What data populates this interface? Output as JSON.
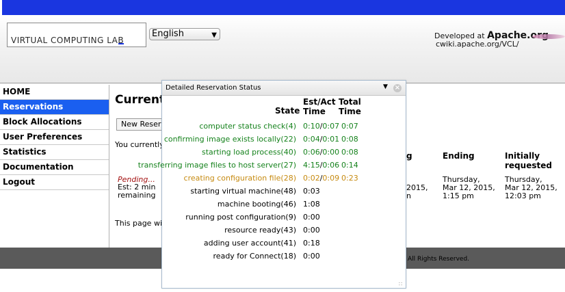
{
  "header": {
    "logo_text": "VIRTUAL COMPUTING LAB",
    "language": "English",
    "developed_prefix": "Developed at ",
    "developed_org": "Apache.org",
    "developed_link": "cwiki.apache.org/VCL/"
  },
  "sidebar": {
    "items": [
      {
        "label": "HOME"
      },
      {
        "label": "Reservations"
      },
      {
        "label": "Block Allocations"
      },
      {
        "label": "User Preferences"
      },
      {
        "label": "Statistics"
      },
      {
        "label": "Documentation"
      },
      {
        "label": "Logout"
      }
    ]
  },
  "main": {
    "title": "Current I",
    "new_reservation": "New Reservat",
    "currently": "You currently h",
    "pending": "Pending...",
    "est_line1": "Est: 2 min",
    "est_line2": "remaining",
    "page_will": "This page will a",
    "col_starting_partial": "g",
    "col_ending": "Ending",
    "col_initially_1": "Initially",
    "col_initially_2": "requested",
    "starting_partial_1": "2015,",
    "starting_partial_2": "n",
    "ending_1": "Thursday,",
    "ending_2": "Mar 12, 2015,",
    "ending_3": "1:15 pm",
    "initially_1": "Thursday,",
    "initially_2": "Mar 12, 2015,",
    "initially_3": "12:03 pm"
  },
  "footer": {
    "text": "All Rights Reserved."
  },
  "dialog": {
    "title": "Detailed Reservation Status",
    "col_state": "State",
    "col_estact_1": "Est/Act",
    "col_estact_2": "Time",
    "col_total_1": "Total",
    "col_total_2": "Time",
    "rows": [
      {
        "state": "computer status check(4)",
        "est": "0:10",
        "act": "0:07",
        "total": "0:07",
        "status": "green"
      },
      {
        "state": "confirming image exists locally(22)",
        "est": "0:04",
        "act": "0:01",
        "total": "0:08",
        "status": "green"
      },
      {
        "state": "starting load process(40)",
        "est": "0:06",
        "act": "0:00",
        "total": "0:08",
        "status": "green"
      },
      {
        "state": "transferring image files to host server(27)",
        "est": "4:15",
        "act": "0:06",
        "total": "0:14",
        "status": "green"
      },
      {
        "state": "creating configuration file(28)",
        "est": "0:02",
        "act": "0:09",
        "total": "0:23",
        "status": "orange"
      },
      {
        "state": "starting virtual machine(48)",
        "est": "0:03",
        "act": "",
        "total": "",
        "status": "black"
      },
      {
        "state": "machine booting(46)",
        "est": "1:08",
        "act": "",
        "total": "",
        "status": "black"
      },
      {
        "state": "running post configuration(9)",
        "est": "0:00",
        "act": "",
        "total": "",
        "status": "black"
      },
      {
        "state": "resource ready(43)",
        "est": "0:00",
        "act": "",
        "total": "",
        "status": "black"
      },
      {
        "state": "adding user account(41)",
        "est": "0:18",
        "act": "",
        "total": "",
        "status": "black"
      },
      {
        "state": "ready for Connect(18)",
        "est": "0:00",
        "act": "",
        "total": "",
        "status": "black"
      }
    ]
  },
  "colors": {
    "topbar": "#1a36e0",
    "nav_active": "#1a5ff0",
    "done_green": "#15821c",
    "current_orange": "#c68a10"
  }
}
